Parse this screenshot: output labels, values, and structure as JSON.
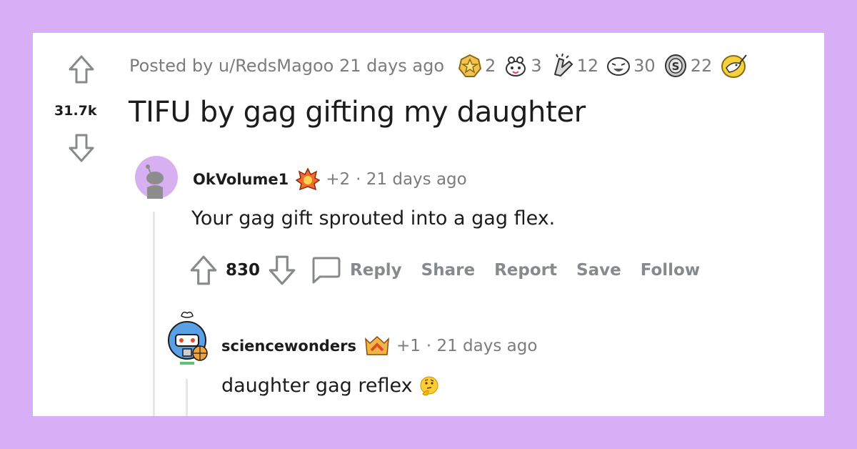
{
  "post": {
    "score": "31.7k",
    "posted_by": "Posted by u/RedsMagoo 21 days ago",
    "title": "TIFU by gag gifting my daughter",
    "awards": [
      {
        "icon": "gold-star-award-icon",
        "count": "2"
      },
      {
        "icon": "wholesome-award-icon",
        "count": "3"
      },
      {
        "icon": "bless-up-award-icon",
        "count": "12"
      },
      {
        "icon": "laughing-face-award-icon",
        "count": "30"
      },
      {
        "icon": "silver-coin-award-icon",
        "count": "22"
      },
      {
        "icon": "narwhal-award-icon",
        "count": ""
      }
    ]
  },
  "comments": [
    {
      "user": "OkVolume1",
      "flair_icon": "fire-award-icon",
      "score_delta": "+2",
      "time": "· 21 days ago",
      "text": "Your gag gift sprouted into a gag flex.",
      "votes": "830",
      "actions": [
        "Reply",
        "Share",
        "Report",
        "Save",
        "Follow"
      ]
    },
    {
      "user": "sciencewonders",
      "flair_icon": "rank-chevron-award-icon",
      "score_delta": "+1",
      "time": "· 21 days ago",
      "text": "daughter gag reflex",
      "emoji_icon": "thinking-face-icon"
    }
  ],
  "colors": {
    "background": "#d8aef7",
    "card": "#ffffff",
    "muted": "#7c7c7c",
    "avatar_purple": "#d6b0f0"
  }
}
